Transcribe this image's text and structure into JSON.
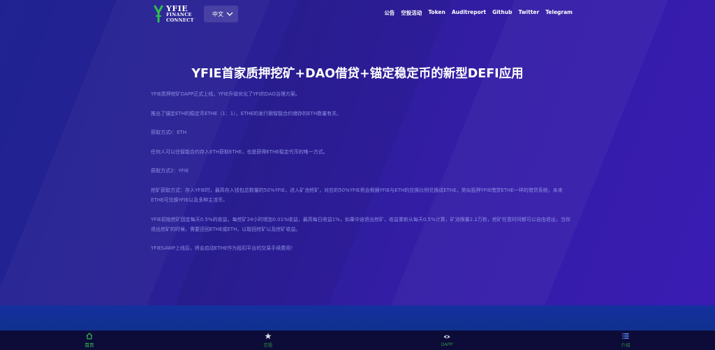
{
  "header": {
    "logo": {
      "line1": "YFIE",
      "line2": "FINANCE",
      "line3": "CONNECT"
    },
    "language": "中文",
    "nav": [
      "公告",
      "空投活动",
      "Token",
      "Auditreport",
      "Github",
      "Twitter",
      "Telegram"
    ]
  },
  "main": {
    "title": "YFIE首家质押挖矿+DAO借贷+锚定稳定币的新型DEFI应用",
    "paragraphs": [
      "YFIE质押挖矿DAPP正式上线，YFIE升级优化了YFI的DAO治理方案。",
      "推出了锚定ETH的稳定币ETHE（1：1），ETHE的发行跟智能合约储存的ETH数量有关。",
      "获取方式I：ETH",
      "任何人可以往智能合约存入ETH获取ETHE，也是获得ETHE稳定代币的唯一方式。",
      "获取方式2：YFIE",
      "挖矿获取方式：存入YFIE时，最高存入钱包总数量的50%YFIE，进入矿池挖矿，对应的50%YFIE将会根据YFIE与ETH的兑换比例兑换成ETHE，类似抵押YFIE借贷ETHE一样的借贷系统，未来ETHE可兑换YFIE以及多种主流币。",
      "YFIE初始挖矿固定每天0.5%的收益，每挖矿24小时增加0.01%收益，最高每日收益1%，如果中途退出挖矿，收益重新从每天0.5%计算，矿池限量2.2万枚，挖矿任意时间都可以自由退出，当你退出挖矿的时候，需要还回ETHE或ETH，以取回挖矿以及挖矿收益。",
      "YFIESAWP上线后，将会启动ETHE作为抵扣平台的交易手续费用！"
    ]
  },
  "bottom_nav": [
    {
      "label": "首页",
      "icon": "home-icon"
    },
    {
      "label": "空投",
      "icon": "star-icon"
    },
    {
      "label": "DAPP",
      "icon": "eye-icon"
    },
    {
      "label": "介绍",
      "icon": "list-icon"
    }
  ],
  "colors": {
    "accent": "#3fd45a",
    "background": "#2a1f8c",
    "text_muted": "#8e8fe3"
  }
}
